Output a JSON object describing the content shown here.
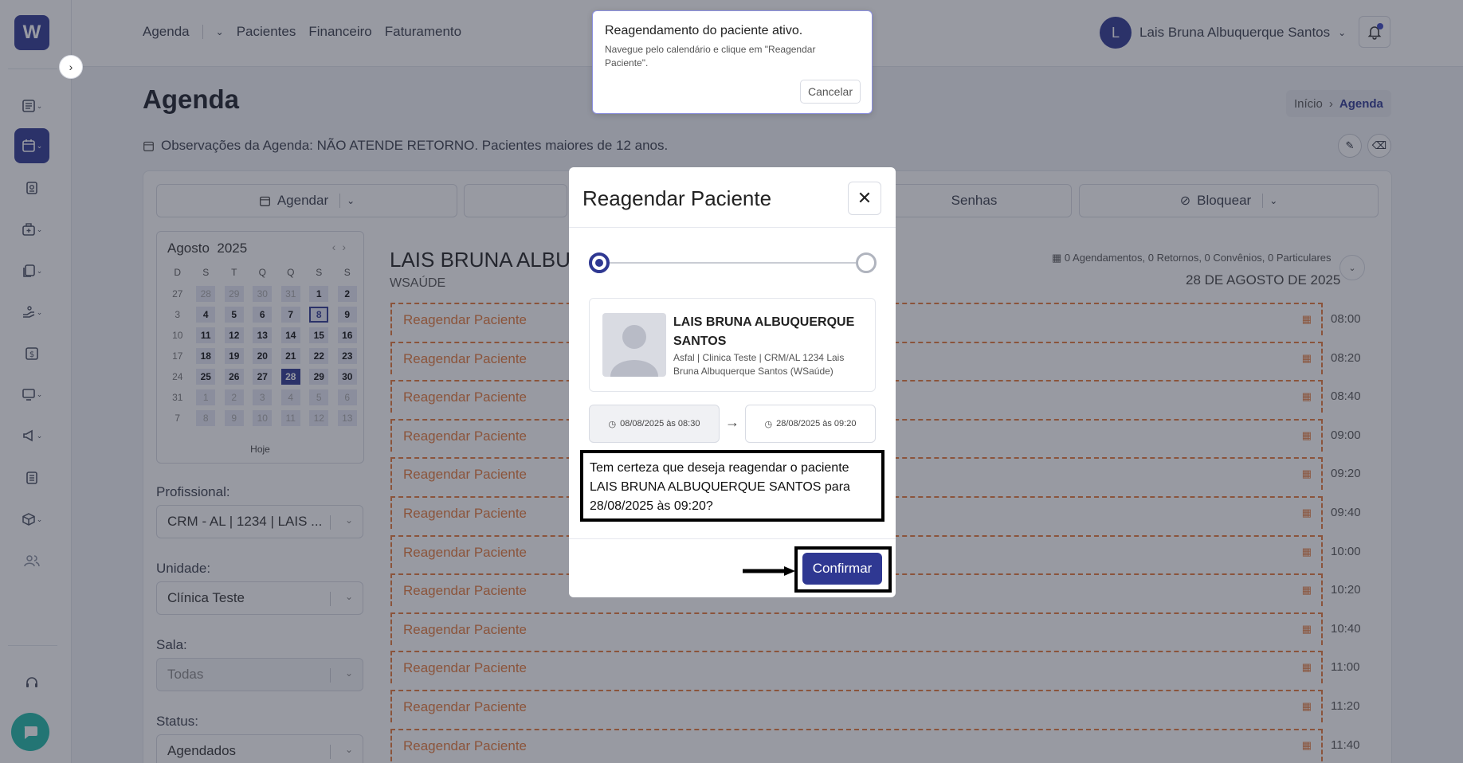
{
  "app": {
    "logo_letter": "W",
    "brand_color": "#2f3892"
  },
  "topnav": {
    "items": [
      "Agenda",
      "Pacientes",
      "Financeiro",
      "Faturamento"
    ],
    "user_initial": "L",
    "user_name": "Lais Bruna Albuquerque Santos"
  },
  "page": {
    "title": "Agenda",
    "breadcrumb": [
      "Início",
      "Agenda"
    ],
    "observations": "Observações da Agenda: NÃO ATENDE RETORNO. Pacientes maiores de 12 anos."
  },
  "actions": {
    "schedule": "Agendar",
    "passwords": "Senhas",
    "block": "Bloquear"
  },
  "calendar": {
    "month": "Agosto",
    "year": "2025",
    "weekdays": [
      "D",
      "S",
      "T",
      "Q",
      "Q",
      "S",
      "S"
    ],
    "weeks": [
      [
        "27",
        "28",
        "29",
        "30",
        "31",
        "1",
        "2"
      ],
      [
        "3",
        "4",
        "5",
        "6",
        "7",
        "8",
        "9"
      ],
      [
        "10",
        "11",
        "12",
        "13",
        "14",
        "15",
        "16"
      ],
      [
        "17",
        "18",
        "19",
        "20",
        "21",
        "22",
        "23"
      ],
      [
        "24",
        "25",
        "26",
        "27",
        "28",
        "29",
        "30"
      ],
      [
        "31",
        "1",
        "2",
        "3",
        "4",
        "5",
        "6"
      ],
      [
        "7",
        "8",
        "9",
        "10",
        "11",
        "12",
        "13"
      ]
    ],
    "today_label": "Hoje",
    "selected_day": "8",
    "current_day": "28"
  },
  "filters": {
    "professional_label": "Profissional:",
    "professional_value": "CRM - AL | 1234 | LAIS ...",
    "unit_label": "Unidade:",
    "unit_value": "Clínica Teste",
    "room_label": "Sala:",
    "room_value": "Todas",
    "status_label": "Status:",
    "status_value": "Agendados"
  },
  "schedule": {
    "professional_name": "LAIS BRUNA ALBU",
    "subtitle": "WSAÚDE",
    "summary": "0 Agendamentos, 0 Retornos, 0 Convênios, 0 Particulares",
    "date": "28 DE AGOSTO DE 2025",
    "slot_label": "Reagendar Paciente",
    "times": [
      "08:00",
      "08:20",
      "08:40",
      "09:00",
      "09:20",
      "09:40",
      "10:00",
      "10:20",
      "10:40",
      "11:00",
      "11:20",
      "11:40"
    ]
  },
  "toast": {
    "title": "Reagendamento do paciente ativo.",
    "message": "Navegue pelo calendário e clique em \"Reagendar Paciente\".",
    "cancel": "Cancelar"
  },
  "modal": {
    "title": "Reagendar Paciente",
    "patient_name": "LAIS BRUNA ALBUQUERQUE SANTOS",
    "patient_info": "Asfal | Clinica Teste | CRM/AL 1234 Lais Bruna Albuquerque Santos (WSaúde)",
    "from_time": "08/08/2025 às 08:30",
    "to_time": "28/08/2025 às 09:20",
    "confirm_text": "Tem certeza que deseja reagendar o paciente LAIS BRUNA ALBUQUERQUE SANTOS para 28/08/2025 às 09:20?",
    "confirm_button": "Confirmar"
  }
}
